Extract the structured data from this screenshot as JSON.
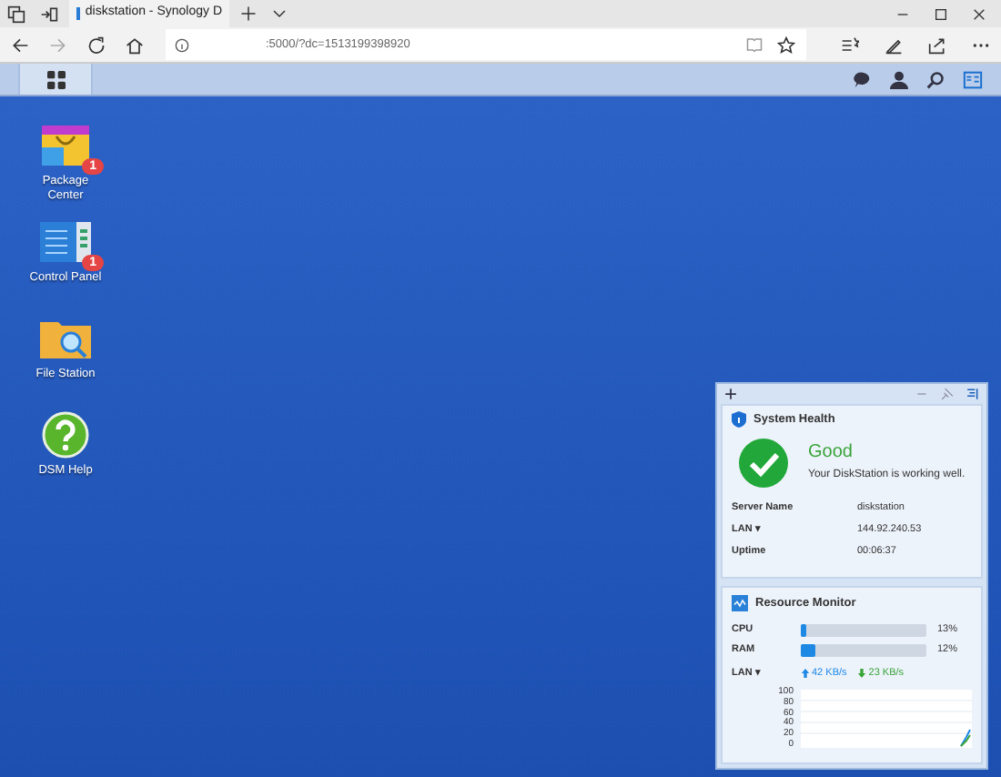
{
  "browser": {
    "tab_title": "diskstation - Synology D",
    "address": ":5000/?dc=1513199398920"
  },
  "desktop_icons": [
    {
      "kind": "package",
      "label": "Package Center",
      "badge": "1"
    },
    {
      "kind": "control",
      "label": "Control Panel",
      "badge": "1"
    },
    {
      "kind": "files",
      "label": "File Station"
    },
    {
      "kind": "help",
      "label": "DSM Help"
    }
  ],
  "system_health": {
    "title": "System Health",
    "status": "Good",
    "message": "Your DiskStation is working well.",
    "rows": [
      {
        "label": "Server Name",
        "value": "diskstation"
      },
      {
        "label": "LAN ▾",
        "value": "144.92.240.53"
      },
      {
        "label": "Uptime",
        "value": "00:06:37"
      }
    ]
  },
  "resource_monitor": {
    "title": "Resource Monitor",
    "meters": [
      {
        "label": "CPU",
        "level": 0.04,
        "reading": "13%"
      },
      {
        "label": "RAM",
        "level": 0.12,
        "reading": "12%"
      }
    ],
    "lan_label": "LAN ▾",
    "upload": "42 KB/s",
    "download": "23 KB/s",
    "chart_axis_labels": [
      "100",
      "80",
      "60",
      "40",
      "20",
      "0"
    ]
  }
}
